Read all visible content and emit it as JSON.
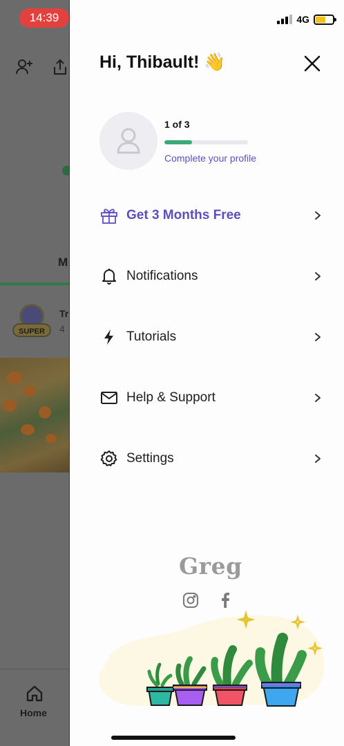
{
  "status_bar": {
    "time": "14:39",
    "network": "4G"
  },
  "background_app": {
    "tab_partial": "M",
    "badge_label": "SUPER",
    "row_title_partial": "Tr",
    "row_sub_partial": "4",
    "home_label": "Home"
  },
  "drawer": {
    "greeting": "Hi, Thibault! 👋",
    "profile": {
      "progress_text": "1 of 3",
      "progress_fraction": 0.33,
      "complete_link": "Complete your profile"
    },
    "menu": [
      {
        "label": "Get 3 Months Free",
        "icon": "gift-icon",
        "promo": true
      },
      {
        "label": "Notifications",
        "icon": "bell-icon",
        "promo": false
      },
      {
        "label": "Tutorials",
        "icon": "lightning-icon",
        "promo": false
      },
      {
        "label": "Help & Support",
        "icon": "mail-icon",
        "promo": false
      },
      {
        "label": "Settings",
        "icon": "gear-icon",
        "promo": false
      }
    ],
    "footer": {
      "brand": "Greg",
      "socials": [
        "instagram-icon",
        "facebook-icon"
      ]
    }
  },
  "colors": {
    "accent": "#5b4fc0",
    "progress": "#3aaa7a",
    "time_pill": "#e2413e"
  }
}
